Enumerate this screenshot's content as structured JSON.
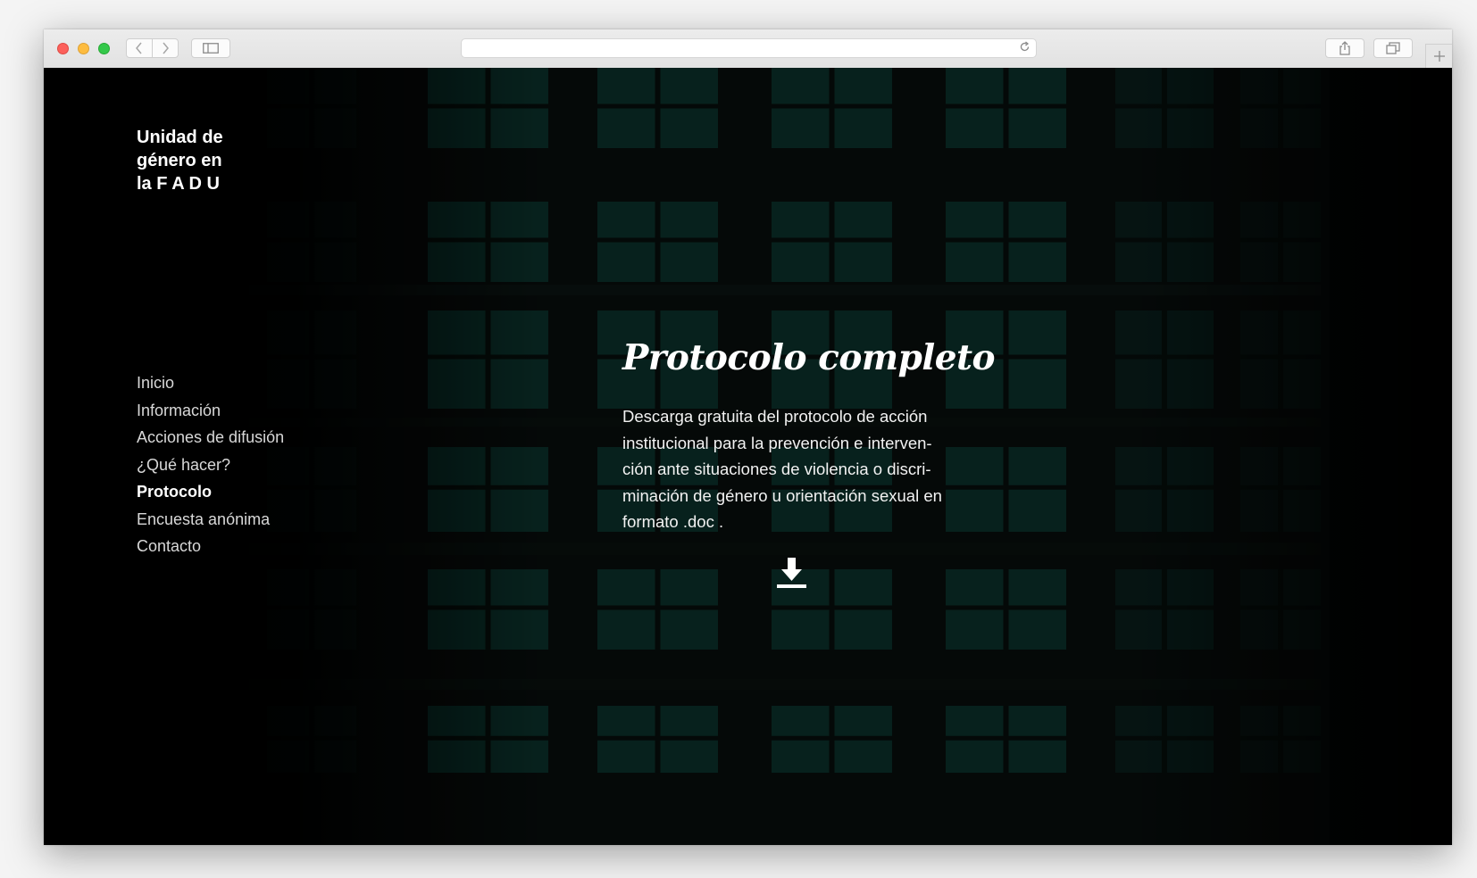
{
  "browser": {
    "nav_back_icon": "chevron-left-icon",
    "nav_forward_icon": "chevron-right-icon",
    "reload_icon": "reload-icon"
  },
  "site": {
    "logo_lines": [
      "Unidad de",
      "género  en",
      "la F A D U"
    ],
    "nav": [
      {
        "label": "Inicio",
        "active": false
      },
      {
        "label": "Información",
        "active": false
      },
      {
        "label": "Acciones de difusión",
        "active": false
      },
      {
        "label": "¿Qué hacer?",
        "active": false
      },
      {
        "label": "Protocolo",
        "active": true
      },
      {
        "label": "Encuesta anónima",
        "active": false
      },
      {
        "label": "Contacto",
        "active": false
      }
    ]
  },
  "main": {
    "title": "Protocolo completo",
    "description_lines": [
      "Descarga gratuita del protocolo de acción",
      "institucional para la prevención e interven-",
      "ción ante situaciones de violencia o discri-",
      "minación de género u orientación sexual en",
      "formato .doc ."
    ],
    "download_icon": "download-icon"
  },
  "colors": {
    "background": "#040807",
    "window_glass": "#0d3a33",
    "text": "#ffffff"
  }
}
